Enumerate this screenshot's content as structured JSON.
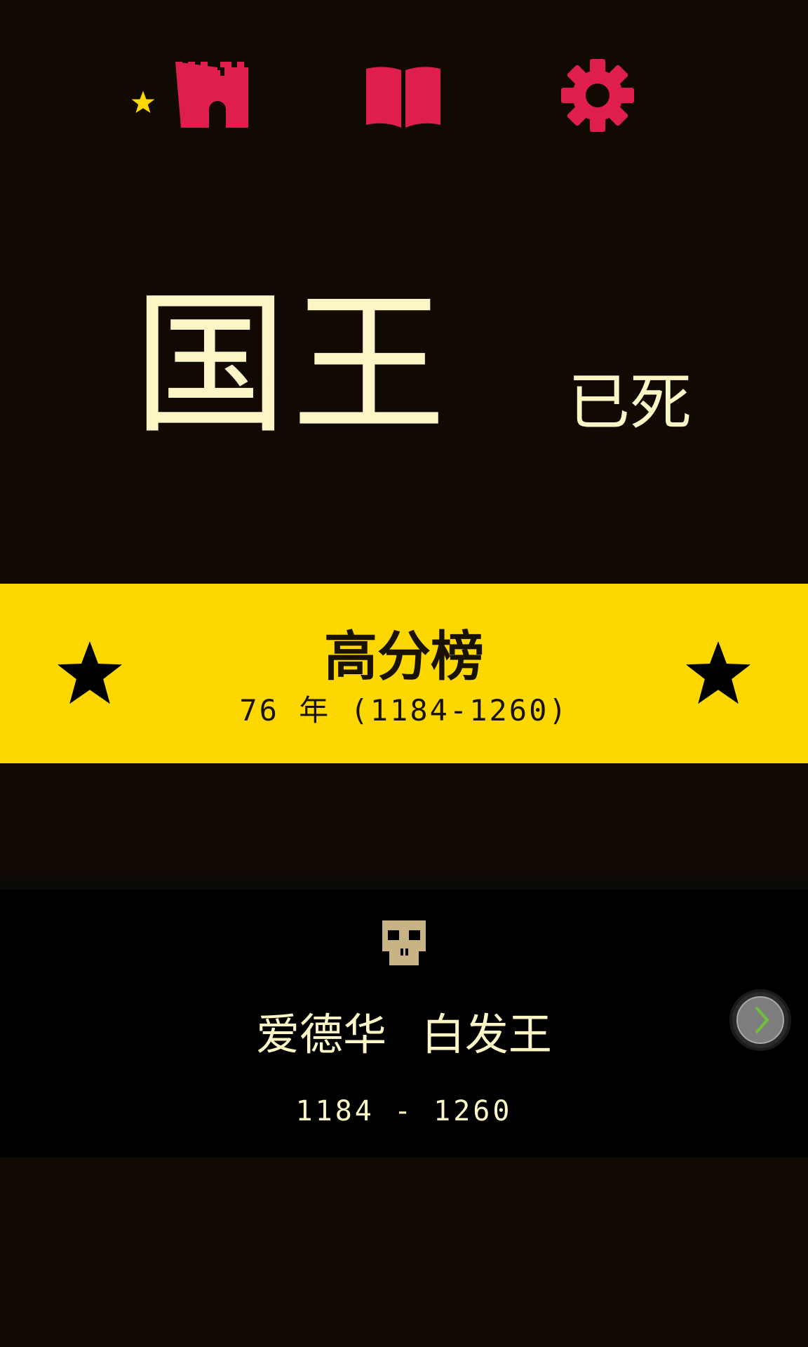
{
  "colors": {
    "background": "#110a03",
    "accent_red": "#e01e4e",
    "accent_yellow": "#fdd800",
    "text_cream": "#fcf6c6",
    "skull": "#c7b384",
    "next_chevron": "#6fbf3a"
  },
  "toolbar": {
    "castle_icon": "castle-icon",
    "small_star_icon": "star-icon",
    "book_icon": "book-icon",
    "settings_icon": "gear-icon"
  },
  "title": {
    "main": "国王",
    "sub": "已死"
  },
  "high_score": {
    "title": "高分榜",
    "detail": "76 年 (1184-1260)",
    "icon": "star-icon"
  },
  "king": {
    "icon": "skull-icon",
    "name": "爱德华 白发王",
    "years": "1184 - 1260"
  },
  "next_button": {
    "icon": "chevron-right-icon"
  }
}
